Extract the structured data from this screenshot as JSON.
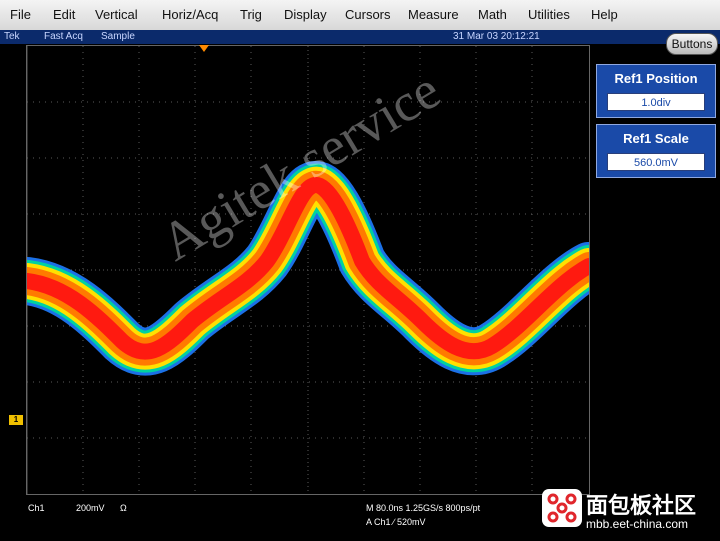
{
  "menu": [
    "File",
    "Edit",
    "Vertical",
    "Horiz/Acq",
    "Trig",
    "Display",
    "Cursors",
    "Measure",
    "Math",
    "Utilities",
    "Help"
  ],
  "status": {
    "tab": "Tek",
    "mode": "Fast Acq",
    "acq": "Sample",
    "datetime": "31 Mar 03 20:12:21"
  },
  "buttons_label": "Buttons",
  "side_panel": [
    {
      "label": "Ref1 Position",
      "value": "1.0div"
    },
    {
      "label": "Ref1 Scale",
      "value": "560.0mV"
    }
  ],
  "bottom": {
    "ch": "Ch1",
    "volts": "200mV",
    "ohm": "Ω",
    "timebase": "M 80.0ns 1.25GS/s 800ps/pt",
    "trigger": "A Ch1 ∕ 520mV"
  },
  "channel_marker": "1",
  "watermark": "Agitek service",
  "logo": {
    "cn": "面包板社区",
    "url": "mbb.eet-china.com"
  },
  "colors": {
    "menu_bg": "#dcdcdc",
    "status_bg": "#0b2a6b",
    "panel_bg": "#1a4aa8",
    "channel": "#f0c000",
    "trigger": "#ff8a00"
  }
}
